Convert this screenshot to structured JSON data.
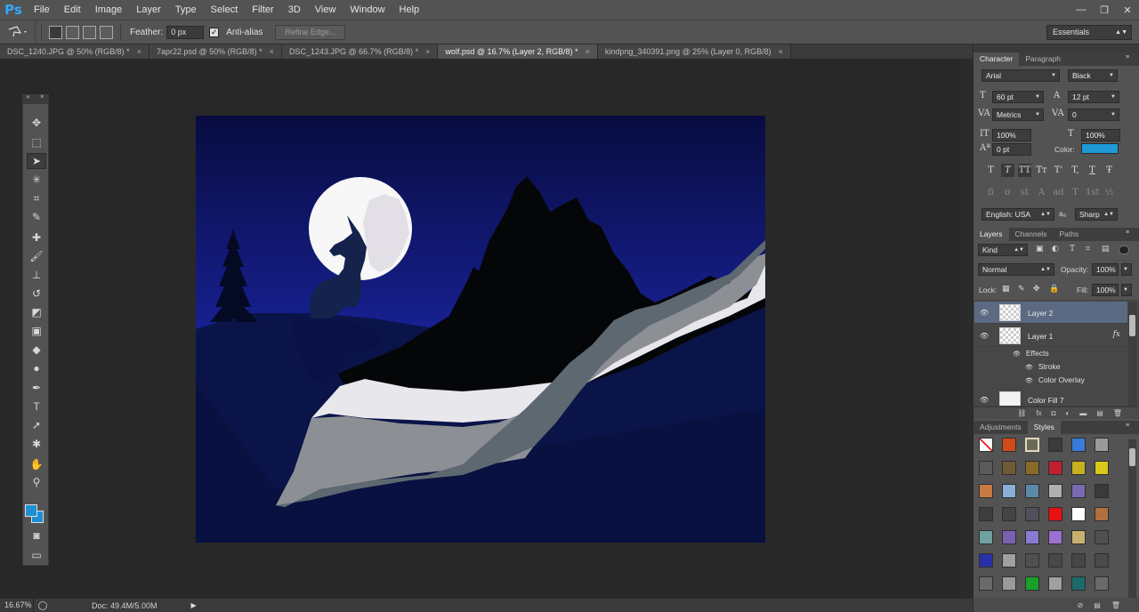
{
  "app": {
    "logo": "Ps",
    "menu": [
      "File",
      "Edit",
      "Image",
      "Layer",
      "Type",
      "Select",
      "Filter",
      "3D",
      "View",
      "Window",
      "Help"
    ],
    "window_controls": [
      "—",
      "❐",
      "✕"
    ]
  },
  "options": {
    "feather_label": "Feather:",
    "feather_value": "0 px",
    "antialias_label": "Anti-alias",
    "antialias_checked": "✓",
    "refine_edge": "Refine Edge...",
    "workspace": "Essentials"
  },
  "tabs": [
    {
      "label": "DSC_1240.JPG @ 50% (RGB/8) *"
    },
    {
      "label": "7apr22.psd @ 50% (RGB/8) *"
    },
    {
      "label": "DSC_1243.JPG @ 66.7% (RGB/8) *"
    },
    {
      "label": "wolf.psd @ 16.7% (Layer 2, RGB/8) *"
    },
    {
      "label": "kindpng_340391.png @ 25% (Layer 0, RGB/8)"
    }
  ],
  "toolbar": {
    "collapse_left": "»",
    "collapse_right": "×",
    "tools": [
      {
        "name": "move-tool-icon",
        "glyph": "✥"
      },
      {
        "name": "marquee-tool-icon",
        "glyph": "⬚"
      },
      {
        "name": "lasso-tool-icon",
        "glyph": "➤"
      },
      {
        "name": "magic-wand-tool-icon",
        "glyph": "✳"
      },
      {
        "name": "crop-tool-icon",
        "glyph": "⌗"
      },
      {
        "name": "eyedropper-tool-icon",
        "glyph": "✎"
      },
      {
        "name": "healing-brush-tool-icon",
        "glyph": "✚"
      },
      {
        "name": "brush-tool-icon",
        "glyph": "🖌"
      },
      {
        "name": "clone-stamp-tool-icon",
        "glyph": "⊥"
      },
      {
        "name": "history-brush-tool-icon",
        "glyph": "↺"
      },
      {
        "name": "eraser-tool-icon",
        "glyph": "◩"
      },
      {
        "name": "gradient-tool-icon",
        "glyph": "▣"
      },
      {
        "name": "blur-tool-icon",
        "glyph": "◆"
      },
      {
        "name": "dodge-tool-icon",
        "glyph": "●"
      },
      {
        "name": "pen-tool-icon",
        "glyph": "✒"
      },
      {
        "name": "type-tool-icon",
        "glyph": "T"
      },
      {
        "name": "path-selection-tool-icon",
        "glyph": "➚"
      },
      {
        "name": "shape-tool-icon",
        "glyph": "✱"
      },
      {
        "name": "hand-tool-icon",
        "glyph": "✋"
      },
      {
        "name": "zoom-tool-icon",
        "glyph": "⚲"
      }
    ],
    "colors": {
      "foreground": "#1e8fd3",
      "background": "#1e8fd3"
    },
    "quick_mask": "◙",
    "screen_mode": "▭"
  },
  "status": {
    "zoom": "16.67%",
    "doc": "Doc: 49.4M/5.00M",
    "arrow": "▶"
  },
  "character": {
    "tabs": [
      "Character",
      "Paragraph"
    ],
    "font_family": "Arial",
    "font_style": "Black",
    "font_size": "60 pt",
    "leading": "12 pt",
    "kerning": "Metrics",
    "tracking": "0",
    "vertical_scale": "100%",
    "horizontal_scale": "100%",
    "baseline_shift": "0 pt",
    "color_label": "Color:",
    "color": "#1e9ad6",
    "type_buttons": [
      "T",
      "T",
      "TT",
      "Tт",
      "T'",
      "T,",
      "T",
      "Ŧ"
    ],
    "ot_buttons": [
      "fi",
      "σ",
      "st",
      "A",
      "ad",
      "T",
      "1st",
      "½"
    ],
    "language": "English: USA",
    "aa_label": "aₐ",
    "antialias": "Sharp"
  },
  "layers": {
    "tabs": [
      "Layers",
      "Channels",
      "Paths"
    ],
    "filter": "Kind",
    "blend_mode": "Normal",
    "opacity_label": "Opacity:",
    "opacity": "100%",
    "lock_label": "Lock:",
    "fill_label": "Fill:",
    "fill": "100%",
    "items": [
      {
        "name": "Layer 2",
        "selected": true
      },
      {
        "name": "Layer 1",
        "fx": "fx"
      },
      {
        "name": "Color Fill 7"
      }
    ],
    "effects_label": "Effects",
    "effects": [
      "Stroke",
      "Color Overlay"
    ],
    "footer": [
      "⛓",
      "fx",
      "◘",
      "◐",
      "▬",
      "▤",
      "🗑"
    ]
  },
  "styles": {
    "tabs": [
      "Adjustments",
      "Styles"
    ],
    "swatches": [
      "#ffffff",
      "#d14a1a",
      "#6b6b5a",
      "#3b3b3b",
      "#3a7ad8",
      "#9a9a9a",
      "#5a5a5a",
      "#6e5a34",
      "#8a6a2a",
      "#c02030",
      "#c8b020",
      "#d8c818",
      "#c87a40",
      "#8ab0d8",
      "#5a8aa8",
      "#b0b0b0",
      "#7a6ab0",
      "#3a3a3a",
      "#3e3e3e",
      "#444444",
      "#50505a",
      "#e81010",
      "#ffffff",
      "#b07040",
      "#70a0a0",
      "#7a60b0",
      "#8a7ad0",
      "#9a70d0",
      "#c8b070",
      "#505050",
      "#2a30a8",
      "#a0a0a0",
      "#505050",
      "#484848",
      "#464646",
      "#4a4a4a",
      "#6a6a6a",
      "#9a9a9a",
      "#18a028",
      "#a0a0a0",
      "#1a6a6a",
      "#6a6a6a"
    ],
    "footer": [
      "⊘",
      "▤",
      "🗑"
    ]
  }
}
